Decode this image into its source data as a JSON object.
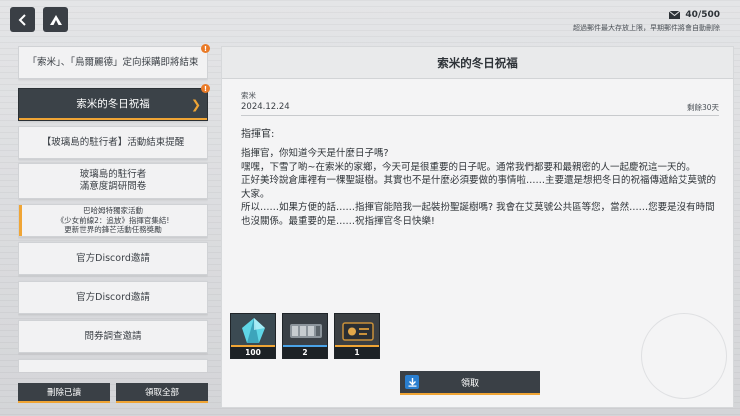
{
  "header": {
    "title": "",
    "mail_count": "40/500",
    "notice": "超過郵件最大存放上限，早期郵件將會自動刪除"
  },
  "mail_list": {
    "items": [
      {
        "label": "「索米」、「烏爾麗德」定向採購即將結束",
        "badge": "!",
        "active": false
      },
      {
        "label": "索米的冬日祝福",
        "badge": "!",
        "active": true
      },
      {
        "label": "【玻璃島的駐行者】活動結束提醒",
        "badge": "",
        "active": false
      },
      {
        "label": "玻璃島的駐行者\n滿意度調研問卷",
        "badge": "",
        "active": false
      },
      {
        "label": "巴哈姆特獨家活動\n《少女前線2：追放》指揮官集結!\n更新世界的鋒芒活動任務獎勵",
        "badge": "",
        "active": false
      },
      {
        "label": "官方Discord邀請",
        "badge": "",
        "active": false
      },
      {
        "label": "官方Discord邀請",
        "badge": "",
        "active": false
      },
      {
        "label": "問券調查邀請",
        "badge": "",
        "active": false
      },
      {
        "label": "",
        "badge": "",
        "active": false
      }
    ],
    "delete_read": "刪除已讀",
    "claim_all": "領取全部"
  },
  "detail": {
    "title": "索米的冬日祝福",
    "sender": "索米",
    "date": "2024.12.24",
    "remaining": "剩餘30天",
    "greeting": "指揮官:",
    "body": [
      "指揮官，你知道今天是什麼日子嗎?",
      "嘿嘿，下雪了喲~在索米的家鄉，今天可是很重要的日子呢。通常我們都要和最親密的人一起慶祝這一天的。",
      "正好美玲說倉庫裡有一棵聖誕樹。其實也不是什麼必須要做的事情啦……主要還是想把冬日的祝福傳遞給艾莫號的大家。",
      "所以……如果方便的話……指揮官能陪我一起裝扮聖誕樹嗎? 我會在艾莫號公共區等您，當然……您要是沒有時間也沒關係。最重要的是……祝指揮官冬日快樂!"
    ],
    "attachments": [
      {
        "icon": "crystal-icon",
        "qty": "100",
        "rarity_color": "#f0a535"
      },
      {
        "icon": "ammo-icon",
        "qty": "2",
        "rarity_color": "#4aa3e8"
      },
      {
        "icon": "ticket-icon",
        "qty": "1",
        "rarity_color": "#f0a535"
      }
    ],
    "claim_label": "領取"
  },
  "colors": {
    "accent": "#f0a535",
    "dark_button": "#3a4046",
    "badge": "#ea7b28"
  }
}
